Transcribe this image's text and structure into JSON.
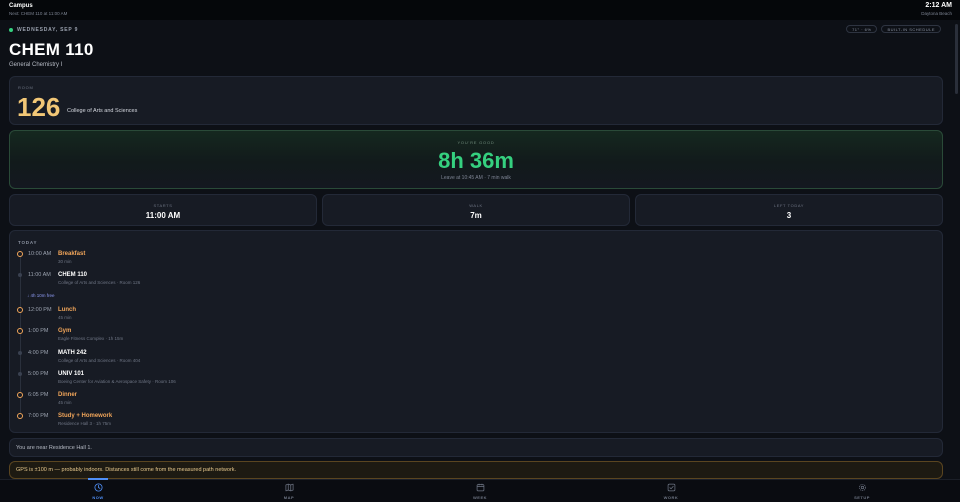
{
  "topbar": {
    "app": "Campus",
    "sub": "Next: CHEM 110 at 11:00 AM",
    "time": "2:12 AM",
    "location": "Daytona Beach"
  },
  "header": {
    "day": "WEDNESDAY, SEP 9",
    "weather_pill": "71° · 6%",
    "schedule_pill": "BUILT-IN SCHEDULE",
    "course": "CHEM 110",
    "course_name": "General Chemistry I"
  },
  "room": {
    "label": "ROOM",
    "number": "126",
    "building": "College of Arts and Sciences"
  },
  "status": {
    "label": "YOU'RE GOOD",
    "countdown": "8h 36m",
    "note": "Leave at 10:45 AM · 7 min walk"
  },
  "stats": [
    {
      "label": "STARTS",
      "value": "11:00 AM"
    },
    {
      "label": "WALK",
      "value": "7m"
    },
    {
      "label": "LEFT TODAY",
      "value": "3"
    }
  ],
  "schedule": {
    "heading": "TODAY",
    "free_gap": "↓ 4h 10m free",
    "events": [
      {
        "time": "10:00 AM",
        "title": "Breakfast",
        "meta": "30 min",
        "kind": "personal"
      },
      {
        "time": "11:00 AM",
        "title": "CHEM 110",
        "meta": "College of Arts and Sciences · Room 126",
        "kind": "class"
      },
      {
        "time": "12:00 PM",
        "title": "Lunch",
        "meta": "45 min",
        "kind": "personal"
      },
      {
        "time": "1:00 PM",
        "title": "Gym",
        "meta": "Eagle Fitness Complex · 1h 15m",
        "kind": "personal"
      },
      {
        "time": "4:00 PM",
        "title": "MATH 242",
        "meta": "College of Arts and Sciences · Room 404",
        "kind": "class"
      },
      {
        "time": "5:00 PM",
        "title": "UNIV 101",
        "meta": "Boeing Center for Aviation & Aerospace Safety · Room 106",
        "kind": "class"
      },
      {
        "time": "6:05 PM",
        "title": "Dinner",
        "meta": "45 min",
        "kind": "personal"
      },
      {
        "time": "7:00 PM",
        "title": "Study + Homework",
        "meta": "Residence Hall 3 · 1h 75m",
        "kind": "personal"
      }
    ]
  },
  "near": "You are near Residence Hall 1.",
  "gps_notice": "GPS is ±100 m — probably indoors. Distances still come from the measured path network.",
  "nav": [
    {
      "label": "NOW",
      "icon": "clock-icon",
      "active": true
    },
    {
      "label": "MAP",
      "icon": "map-icon",
      "active": false
    },
    {
      "label": "WEEK",
      "icon": "calendar-icon",
      "active": false
    },
    {
      "label": "WORK",
      "icon": "checkbox-icon",
      "active": false
    },
    {
      "label": "SETUP",
      "icon": "gear-icon",
      "active": false
    }
  ],
  "colors": {
    "accent_green": "#35d07f",
    "room_gold": "#f2c776",
    "personal_orange": "#f2a65a",
    "nav_active_blue": "#4f8ff7",
    "background": "#0d1016"
  }
}
